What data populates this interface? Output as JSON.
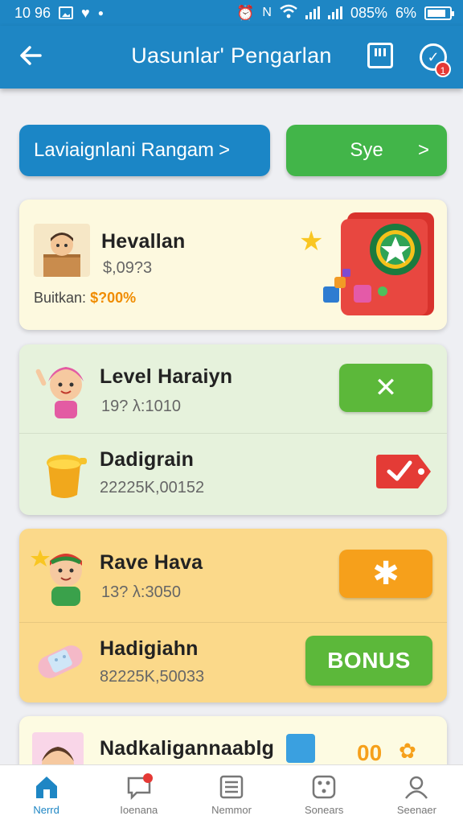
{
  "status_bar": {
    "time": "10 96",
    "signal_text": "085%",
    "battery_text": "6%"
  },
  "header": {
    "title": "Uasunlar' Pengarlan",
    "back_icon": "arrow-back-icon",
    "notification_count": "1"
  },
  "tabs": [
    {
      "label": "Laviaignlani Rangam",
      "chevron": ">"
    },
    {
      "label": "Sye",
      "chevron": ">"
    }
  ],
  "featured": {
    "title": "Hevallan",
    "subtitle": "$,09?3",
    "footer_label": "Buitkan:",
    "footer_value": "$?00%"
  },
  "group_one": [
    {
      "title": "Level Haraiyn",
      "subtitle": "19? λ:1010"
    },
    {
      "title": "Dadigrain",
      "subtitle": "22225K,00152"
    }
  ],
  "group_two": [
    {
      "title": "Rave Hava",
      "subtitle": "13? λ:3050"
    },
    {
      "title": "Hadigiahn",
      "subtitle": "82225K,50033",
      "button": "BONUS"
    }
  ],
  "partial_card": {
    "title": "Nadkaligannaablg",
    "value": "00"
  },
  "bottom_nav": [
    {
      "label": "Nerrd",
      "active": true
    },
    {
      "label": "Ioenana",
      "active": false
    },
    {
      "label": "Nemmor",
      "active": false
    },
    {
      "label": "Sonears",
      "active": false
    },
    {
      "label": "Seenaer",
      "active": false
    }
  ],
  "colors": {
    "primary": "#1e86c4",
    "green": "#42b549",
    "orange": "#f6a01b",
    "red": "#e53935"
  }
}
